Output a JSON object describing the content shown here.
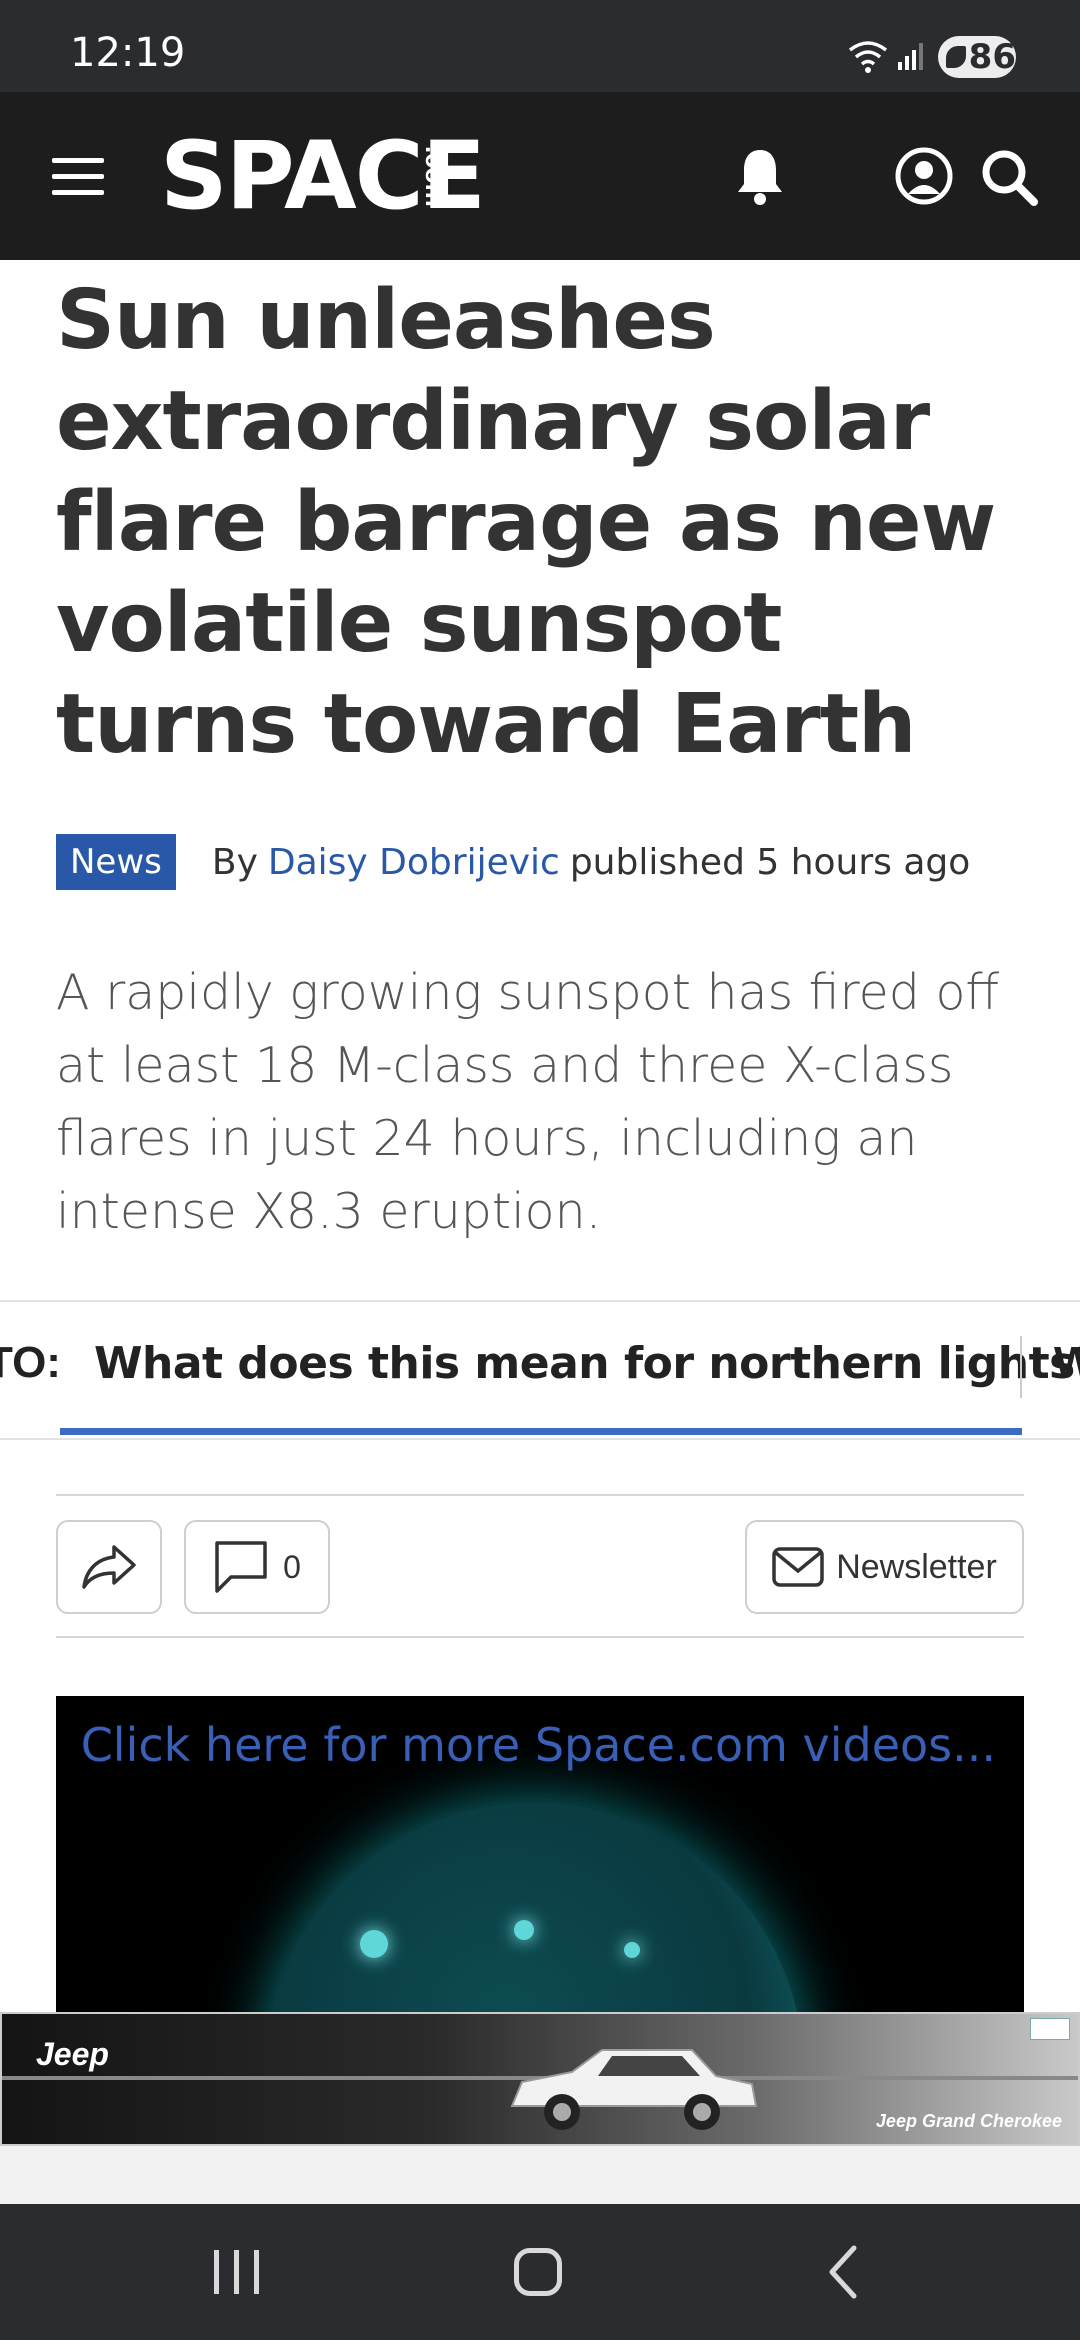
{
  "status_bar": {
    "time": "12:19",
    "battery": "86"
  },
  "site_header": {
    "logo": "SPACE",
    "logo_suffix": ".com"
  },
  "article": {
    "headline": "Sun unleashes extraordinary solar flare barrage as new volatile sunspot turns toward Earth",
    "category": "News",
    "by": "By",
    "author": "Daisy Dobrijevic",
    "published": "published 5 hours ago",
    "lede": "A rapidly growing sunspot has fired off at least 18 M-class and three X-class flares in just 24 hours, including an intense X8.3 eruption."
  },
  "jump_to": {
    "prefix": "TO:",
    "current": "What does this mean for northern lights?",
    "next": "W"
  },
  "share_bar": {
    "comment_count": "0",
    "newsletter_label": "Newsletter"
  },
  "video": {
    "link_text": "Click here for more Space.com videos..."
  },
  "ad": {
    "brand": "Jeep",
    "caption": "Jeep Grand Cherokee"
  },
  "colors": {
    "accent": "#2a58a8",
    "header_bg": "#1d1d1d",
    "status_bg": "#2b2c30"
  },
  "icons": [
    "menu-icon",
    "bell-icon",
    "account-icon",
    "search-icon",
    "share-icon",
    "comment-icon",
    "mail-icon",
    "wifi-icon",
    "signal-icon"
  ]
}
